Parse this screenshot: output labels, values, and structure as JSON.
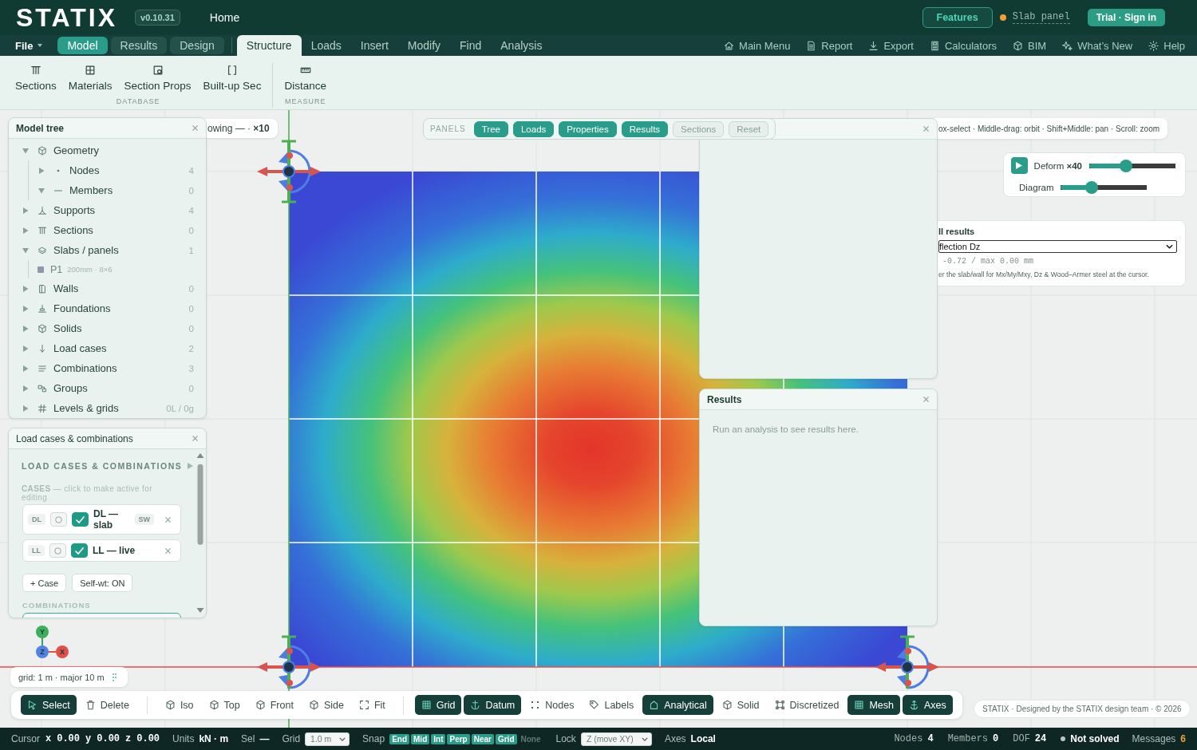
{
  "top_bar": {
    "logo": "STATIX",
    "version": "v0.10.31",
    "home": "Home",
    "features": "Features",
    "project": "Slab panel",
    "sign_in": "Trial · Sign in"
  },
  "menu_bar": {
    "file": "File",
    "modes": [
      {
        "label": "Model",
        "selected": true
      },
      {
        "label": "Results",
        "selected": false
      },
      {
        "label": "Design",
        "selected": false
      }
    ],
    "tabs": [
      {
        "label": "Structure",
        "selected": true
      },
      {
        "label": "Loads",
        "selected": false
      },
      {
        "label": "Insert",
        "selected": false
      },
      {
        "label": "Modify",
        "selected": false
      },
      {
        "label": "Find",
        "selected": false
      },
      {
        "label": "Analysis",
        "selected": false
      }
    ],
    "links": [
      "Main Menu",
      "Report",
      "Export",
      "Calculators",
      "BIM",
      "What’s New",
      "Help"
    ]
  },
  "ribbon": {
    "groups": [
      {
        "label": "DATABASE",
        "tools": [
          "Sections",
          "Materials",
          "Section Props",
          "Built-up Sec"
        ]
      },
      {
        "label": "MEASURE",
        "tools": [
          "Distance"
        ]
      }
    ]
  },
  "canvas": {
    "hint_left": "owing — · **×10**",
    "hint_right": "ox-select · Middle-drag: orbit · Shift+Middle: pan · Scroll: zoom",
    "grid_info": "grid: 1 m · major 10 m",
    "triad": {
      "y": "Y",
      "z": "Z",
      "x": "X"
    }
  },
  "model_tree": {
    "title": "Model tree",
    "items": [
      {
        "label": "Geometry",
        "expanded": true,
        "children": [
          {
            "label": "Nodes",
            "count": "4",
            "expanded": false
          },
          {
            "label": "Members",
            "count": "0",
            "expanded": true
          }
        ]
      },
      {
        "label": "Supports",
        "count": "4",
        "expanded": false
      },
      {
        "label": "Sections",
        "count": "0",
        "expanded": false
      },
      {
        "label": "Slabs / panels",
        "count": "1",
        "expanded": true,
        "children": [
          {
            "label": "P1",
            "detail": "200mm · 8×6"
          }
        ]
      },
      {
        "label": "Walls",
        "count": "0",
        "expanded": false
      },
      {
        "label": "Foundations",
        "count": "0",
        "expanded": false
      },
      {
        "label": "Solids",
        "count": "0",
        "expanded": false
      },
      {
        "label": "Load cases",
        "count": "2",
        "expanded": false
      },
      {
        "label": "Combinations",
        "count": "3",
        "expanded": false
      },
      {
        "label": "Groups",
        "count": "0",
        "expanded": false
      },
      {
        "label": "Levels & grids",
        "count": "0L / 0g",
        "expanded": false
      }
    ]
  },
  "panels_bar": {
    "label": "PANELS",
    "chips": [
      {
        "label": "Tree",
        "on": true
      },
      {
        "label": "Loads",
        "on": true
      },
      {
        "label": "Properties",
        "on": true
      },
      {
        "label": "Results",
        "on": true
      },
      {
        "label": "Sections",
        "on": false
      }
    ],
    "reset": "Reset"
  },
  "view_controls": {
    "sliders": [
      {
        "label": "Deform **×40**",
        "level": 0.41
      },
      {
        "label": "Diagram",
        "level": 0.33
      }
    ]
  },
  "shell_results": {
    "title": "ll results",
    "quantity": "flection Dz",
    "range": "-0.72 / max 0.00 mm",
    "note": "er the slab/wall for Mx/My/Mxy, Dz & Wood–Armer steel at the cursor."
  },
  "results_panel": {
    "title": "Results",
    "message": "Run an analysis to see results here."
  },
  "load_panel": {
    "title": "Load cases & combinations",
    "heading": "LOAD CASES & COMBINATIONS",
    "cases_hint": "**CASES** — click to make active for editing",
    "cases": [
      {
        "code": "DL",
        "active": false,
        "visible": true,
        "name": "DL — slab",
        "badge": "SW"
      },
      {
        "code": "LL",
        "active": false,
        "visible": true,
        "name": "LL — live"
      }
    ],
    "buttons": [
      "+ Case",
      "Self-wt: ON"
    ],
    "combinations_label": "COMBINATIONS"
  },
  "toolbar": {
    "groups": [
      [
        {
          "label": "Select",
          "on": true
        },
        {
          "label": "Delete",
          "on": false
        }
      ],
      [
        {
          "label": "Iso",
          "on": false
        },
        {
          "label": "Top",
          "on": false
        },
        {
          "label": "Front",
          "on": false
        },
        {
          "label": "Side",
          "on": false
        },
        {
          "label": "Fit",
          "on": false
        }
      ],
      [
        {
          "label": "Grid",
          "on": true
        },
        {
          "label": "Datum",
          "on": true
        },
        {
          "label": "Nodes",
          "on": false
        },
        {
          "label": "Labels",
          "on": false
        },
        {
          "label": "Analytical",
          "on": true
        },
        {
          "label": "Solid",
          "on": false
        },
        {
          "label": "Discretized",
          "on": false
        },
        {
          "label": "Mesh",
          "on": true
        },
        {
          "label": "Axes",
          "on": true
        }
      ]
    ]
  },
  "credit": "STATIX · Designed by the STATIX design team · © 2026",
  "status_bar": {
    "cursor_label": "Cursor",
    "coords": [
      {
        "axis": "x",
        "value": "0.00"
      },
      {
        "axis": "y",
        "value": "0.00"
      },
      {
        "axis": "z",
        "value": "0.00"
      }
    ],
    "fields": [
      {
        "label": "Units",
        "value": "kN · m"
      },
      {
        "label": "Sel",
        "value": "—"
      }
    ],
    "grid": {
      "label": "Grid",
      "value": "1.0 m"
    },
    "snap": {
      "label": "Snap",
      "options": [
        {
          "label": "End",
          "on": true
        },
        {
          "label": "Mid",
          "on": true
        },
        {
          "label": "Int",
          "on": true
        },
        {
          "label": "Perp",
          "on": true
        },
        {
          "label": "Near",
          "on": true
        },
        {
          "label": "Grid",
          "on": true
        },
        {
          "label": "None",
          "on": false
        }
      ]
    },
    "lock": {
      "label": "Lock",
      "value": "Z (move XY)"
    },
    "axes": {
      "label": "Axes",
      "value": "Local"
    },
    "counts": [
      {
        "label": "Nodes",
        "value": "4"
      },
      {
        "label": "Members",
        "value": "0"
      },
      {
        "label": "DOF",
        "value": "24"
      }
    ],
    "solve_status": "Not solved",
    "messages": {
      "label": "Messages",
      "value": "6"
    }
  }
}
